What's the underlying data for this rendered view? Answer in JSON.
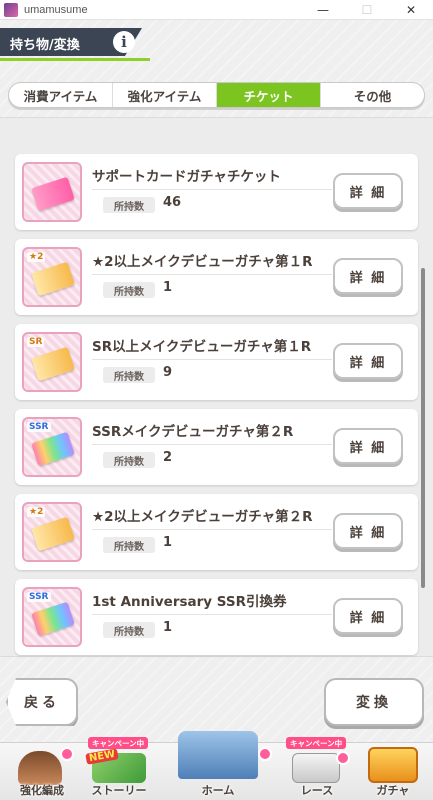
{
  "window": {
    "title": "umamusume",
    "controls": [
      "—",
      "☐",
      "✕"
    ]
  },
  "header": {
    "title": "持ち物/変換",
    "info_glyph": "i"
  },
  "tabs": [
    {
      "label": "消費アイテム",
      "active": false
    },
    {
      "label": "強化アイテム",
      "active": false
    },
    {
      "label": "チケット",
      "active": true
    },
    {
      "label": "その他",
      "active": false
    }
  ],
  "items": [
    {
      "name": "サポートカードガチャチケット",
      "count_label": "所持数",
      "count": "46",
      "detail_label": "詳 細",
      "thumb_tag": ""
    },
    {
      "name": "★2以上メイクデビューガチャ第１R",
      "count_label": "所持数",
      "count": "1",
      "detail_label": "詳 細",
      "thumb_tag": "★2"
    },
    {
      "name": "SR以上メイクデビューガチャ第１R",
      "count_label": "所持数",
      "count": "9",
      "detail_label": "詳 細",
      "thumb_tag": "SR"
    },
    {
      "name": "SSRメイクデビューガチャ第２R",
      "count_label": "所持数",
      "count": "2",
      "detail_label": "詳 細",
      "thumb_tag": "SSR"
    },
    {
      "name": "★2以上メイクデビューガチャ第２R",
      "count_label": "所持数",
      "count": "1",
      "detail_label": "詳 細",
      "thumb_tag": "★2"
    },
    {
      "name": "1st Anniversary SSR引換券",
      "count_label": "所持数",
      "count": "1",
      "detail_label": "詳 細",
      "thumb_tag": "SSR"
    }
  ],
  "buttons": {
    "back": "戻る",
    "exchange": "変換"
  },
  "nav": {
    "items": [
      {
        "label": "強化編成",
        "badge": ""
      },
      {
        "label": "ストーリー",
        "badge": "キャンペーン中",
        "new": "NEW"
      },
      {
        "label": "ホーム",
        "badge": ""
      },
      {
        "label": "レース",
        "badge": "キャンペーン中"
      },
      {
        "label": "ガチャ",
        "badge": ""
      }
    ]
  },
  "colors": {
    "accent_green": "#7cc521",
    "header_dark": "#3b4553",
    "text": "#4b403a",
    "campaign_pink": "#ff4e88"
  }
}
